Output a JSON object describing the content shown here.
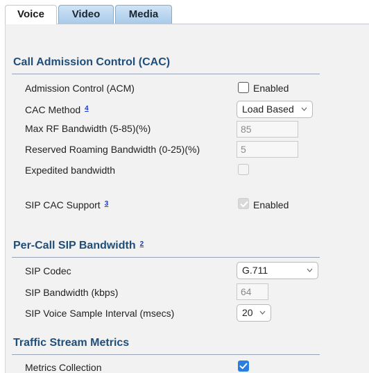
{
  "tabs": [
    {
      "label": "Voice"
    },
    {
      "label": "Video"
    },
    {
      "label": "Media"
    }
  ],
  "cac": {
    "title": "Call Admission Control (CAC)",
    "admission_control": {
      "label": "Admission Control (ACM)",
      "checkbox_label": "Enabled",
      "checked": false
    },
    "cac_method": {
      "label": "CAC Method",
      "footnote": "4",
      "value": "Load Based"
    },
    "max_rf_bandwidth": {
      "label": "Max RF Bandwidth (5-85)(%)",
      "value": "85"
    },
    "reserved_roaming": {
      "label": "Reserved Roaming Bandwidth (0-25)(%)",
      "value": "5"
    },
    "expedited_bandwidth": {
      "label": "Expedited bandwidth",
      "checked": false
    },
    "sip_cac_support": {
      "label": "SIP CAC Support",
      "footnote": "3",
      "checkbox_label": "Enabled",
      "checked": true
    }
  },
  "per_call": {
    "title": "Per-Call SIP Bandwidth",
    "footnote": "2",
    "sip_codec": {
      "label": "SIP Codec",
      "value": "G.711"
    },
    "sip_bandwidth": {
      "label": "SIP Bandwidth (kbps)",
      "value": "64"
    },
    "sample_interval": {
      "label": "SIP Voice Sample Interval (msecs)",
      "value": "20"
    }
  },
  "tsm": {
    "title": "Traffic Stream Metrics",
    "metrics_collection": {
      "label": "Metrics Collection",
      "checked": true
    }
  },
  "icons": {
    "dropdown": "chevron-down-icon",
    "check": "checkmark-icon"
  },
  "colors": {
    "section_title": "#1f4e79",
    "accent_check": "#2a7de1",
    "footnote_link": "#1a39d6"
  }
}
